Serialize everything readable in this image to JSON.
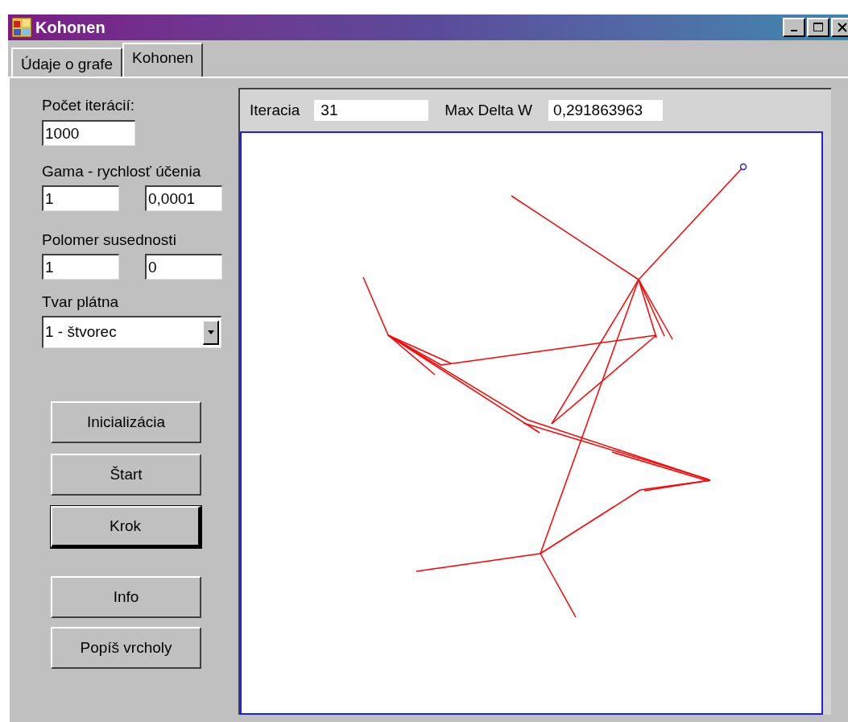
{
  "window": {
    "title": "Kohonen"
  },
  "tabs": [
    {
      "label": "Údaje o grafe",
      "selected": false
    },
    {
      "label": "Kohonen",
      "selected": true
    }
  ],
  "settings": {
    "iterations_label": "Počet iterácií:",
    "iterations_value": "1000",
    "gamma_label": "Gama - rychlosť účenia",
    "gamma_values": [
      "1",
      "0,0001"
    ],
    "radius_label": "Polomer susednosti",
    "radius_values": [
      "1",
      "0"
    ],
    "shape_label": "Tvar plátna",
    "shape_value": "1 - štvorec"
  },
  "run_buttons": [
    {
      "label": "Inicializácia",
      "default": false
    },
    {
      "label": "Štart",
      "default": false
    },
    {
      "label": "Krok",
      "default": true
    }
  ],
  "tool_buttons": [
    {
      "label": "Info",
      "default": false
    },
    {
      "label": "Popíš vrcholy",
      "default": false
    }
  ],
  "status": {
    "iteration_label": "Iteracia",
    "iteration_value": "31",
    "delta_label": "Max Delta W",
    "delta_value": "0,291863963"
  }
}
